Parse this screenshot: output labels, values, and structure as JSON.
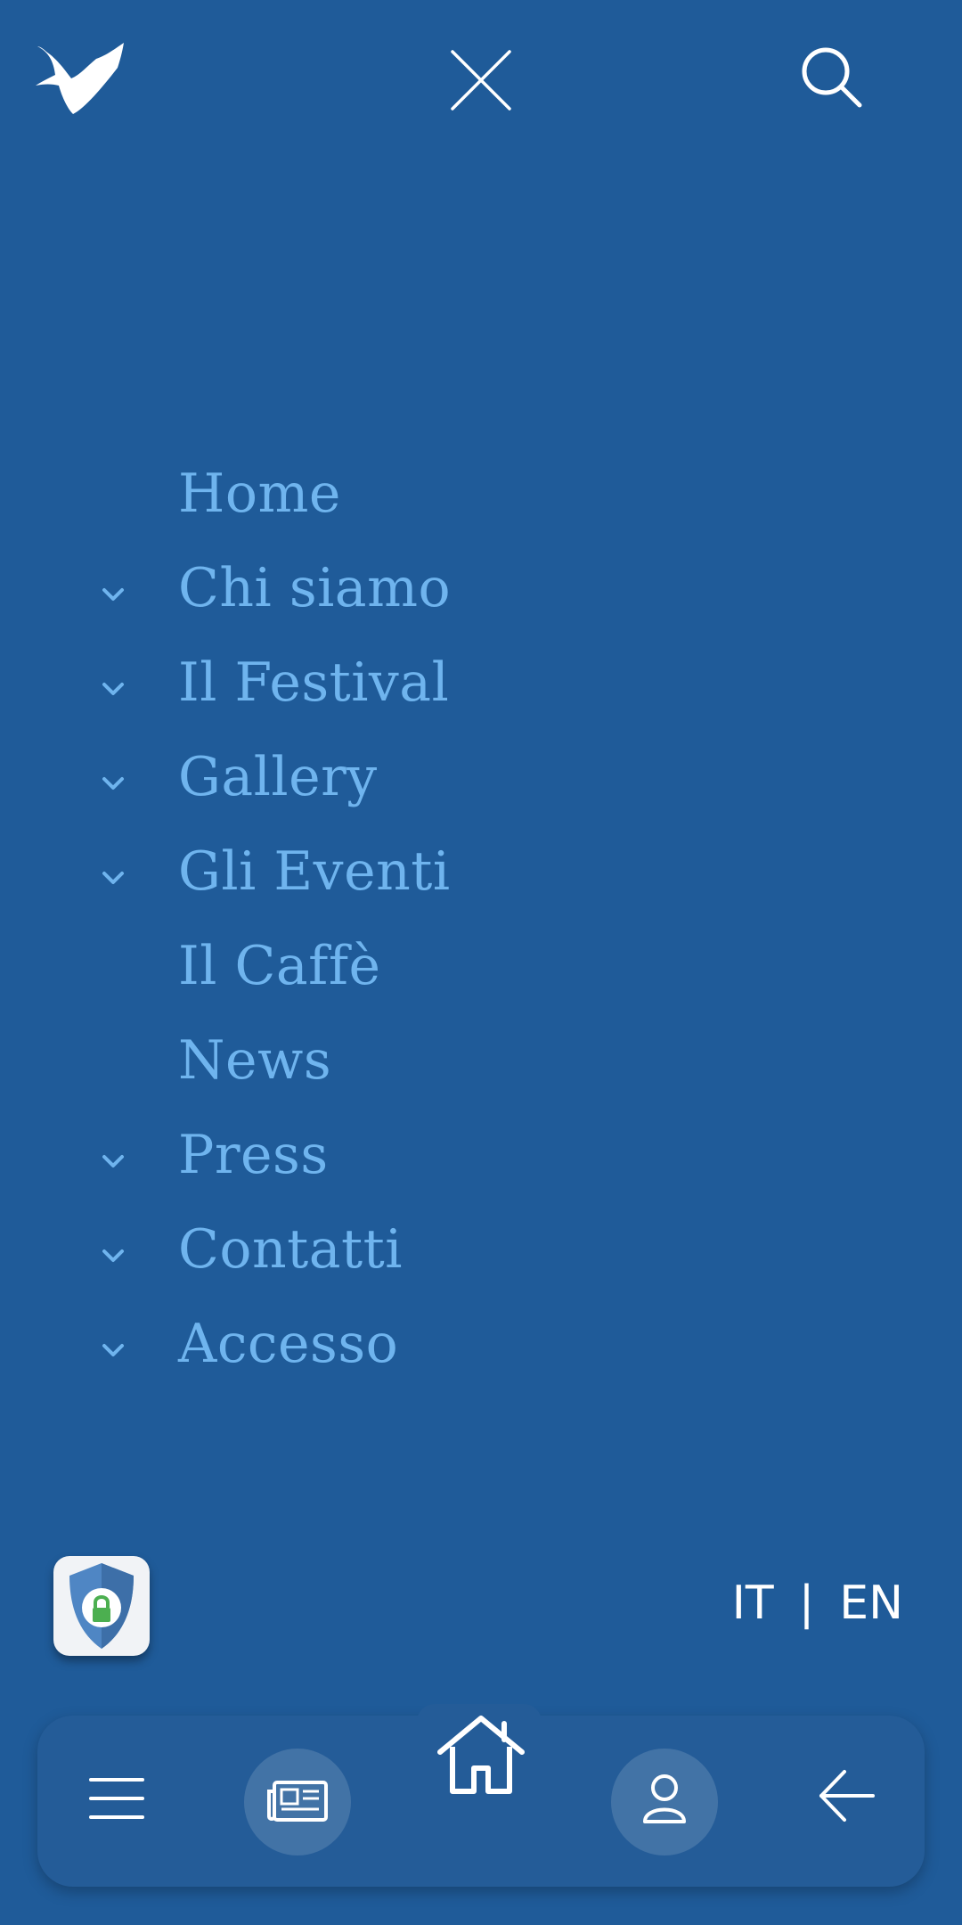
{
  "colors": {
    "background": "#1f5b99",
    "menu_text": "#6fb4ee",
    "nav_bar": "#245c98",
    "icon": "#ffffff",
    "lock_green": "#4caf50"
  },
  "header": {
    "logo_icon": "bird-logo-icon",
    "close_icon": "close-icon",
    "search_icon": "search-icon"
  },
  "menu": {
    "items": [
      {
        "label": "Home",
        "expandable": false
      },
      {
        "label": "Chi siamo",
        "expandable": true
      },
      {
        "label": "Il Festival",
        "expandable": true
      },
      {
        "label": "Gallery",
        "expandable": true
      },
      {
        "label": "Gli Eventi",
        "expandable": true
      },
      {
        "label": "Il Caffè",
        "expandable": false
      },
      {
        "label": "News",
        "expandable": false
      },
      {
        "label": "Press",
        "expandable": true
      },
      {
        "label": "Contatti",
        "expandable": true
      },
      {
        "label": "Accesso",
        "expandable": true
      }
    ]
  },
  "language": {
    "it": "IT",
    "separator": "|",
    "en": "EN"
  },
  "privacy_badge": {
    "icon": "shield-lock-icon"
  },
  "bottom_nav": {
    "items": [
      {
        "icon": "hamburger-menu-icon"
      },
      {
        "icon": "newspaper-icon"
      },
      {
        "icon": "home-icon"
      },
      {
        "icon": "user-icon"
      },
      {
        "icon": "arrow-left-icon"
      }
    ]
  }
}
